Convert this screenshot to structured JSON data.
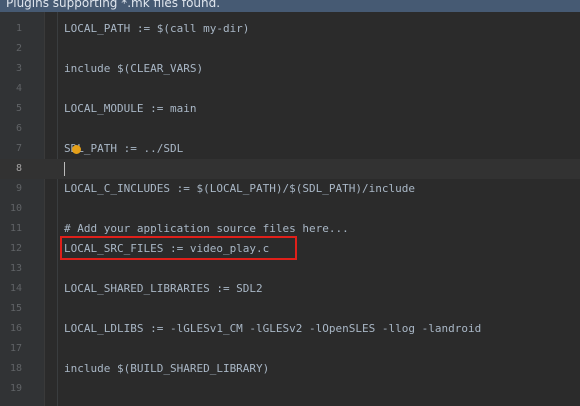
{
  "banner": {
    "text": "Plugins supporting *.mk files found."
  },
  "editor": {
    "current_line": 8,
    "highlighted_line": 12,
    "lines": [
      {
        "num": "1",
        "text": "LOCAL_PATH := $(call my-dir)"
      },
      {
        "num": "2",
        "text": ""
      },
      {
        "num": "3",
        "text": "include $(CLEAR_VARS)"
      },
      {
        "num": "4",
        "text": ""
      },
      {
        "num": "5",
        "text": "LOCAL_MODULE := main"
      },
      {
        "num": "6",
        "text": ""
      },
      {
        "num": "7",
        "text": "SDL_PATH := ../SDL"
      },
      {
        "num": "8",
        "text": ""
      },
      {
        "num": "9",
        "text": "LOCAL_C_INCLUDES := $(LOCAL_PATH)/$(SDL_PATH)/include"
      },
      {
        "num": "10",
        "text": ""
      },
      {
        "num": "11",
        "text": "# Add your application source files here..."
      },
      {
        "num": "12",
        "text": "LOCAL_SRC_FILES := video_play.c"
      },
      {
        "num": "13",
        "text": ""
      },
      {
        "num": "14",
        "text": "LOCAL_SHARED_LIBRARIES := SDL2"
      },
      {
        "num": "15",
        "text": ""
      },
      {
        "num": "16",
        "text": "LOCAL_LDLIBS := -lGLESv1_CM -lGLESv2 -lOpenSLES -llog -landroid"
      },
      {
        "num": "17",
        "text": ""
      },
      {
        "num": "18",
        "text": "include $(BUILD_SHARED_LIBRARY)"
      },
      {
        "num": "19",
        "text": ""
      }
    ]
  },
  "icons": {
    "intention_bulb": "lightbulb-icon"
  },
  "colors": {
    "background": "#2b2b2b",
    "banner": "#465a73",
    "highlight_border": "#e0201a",
    "bulb": "#e5a019"
  }
}
